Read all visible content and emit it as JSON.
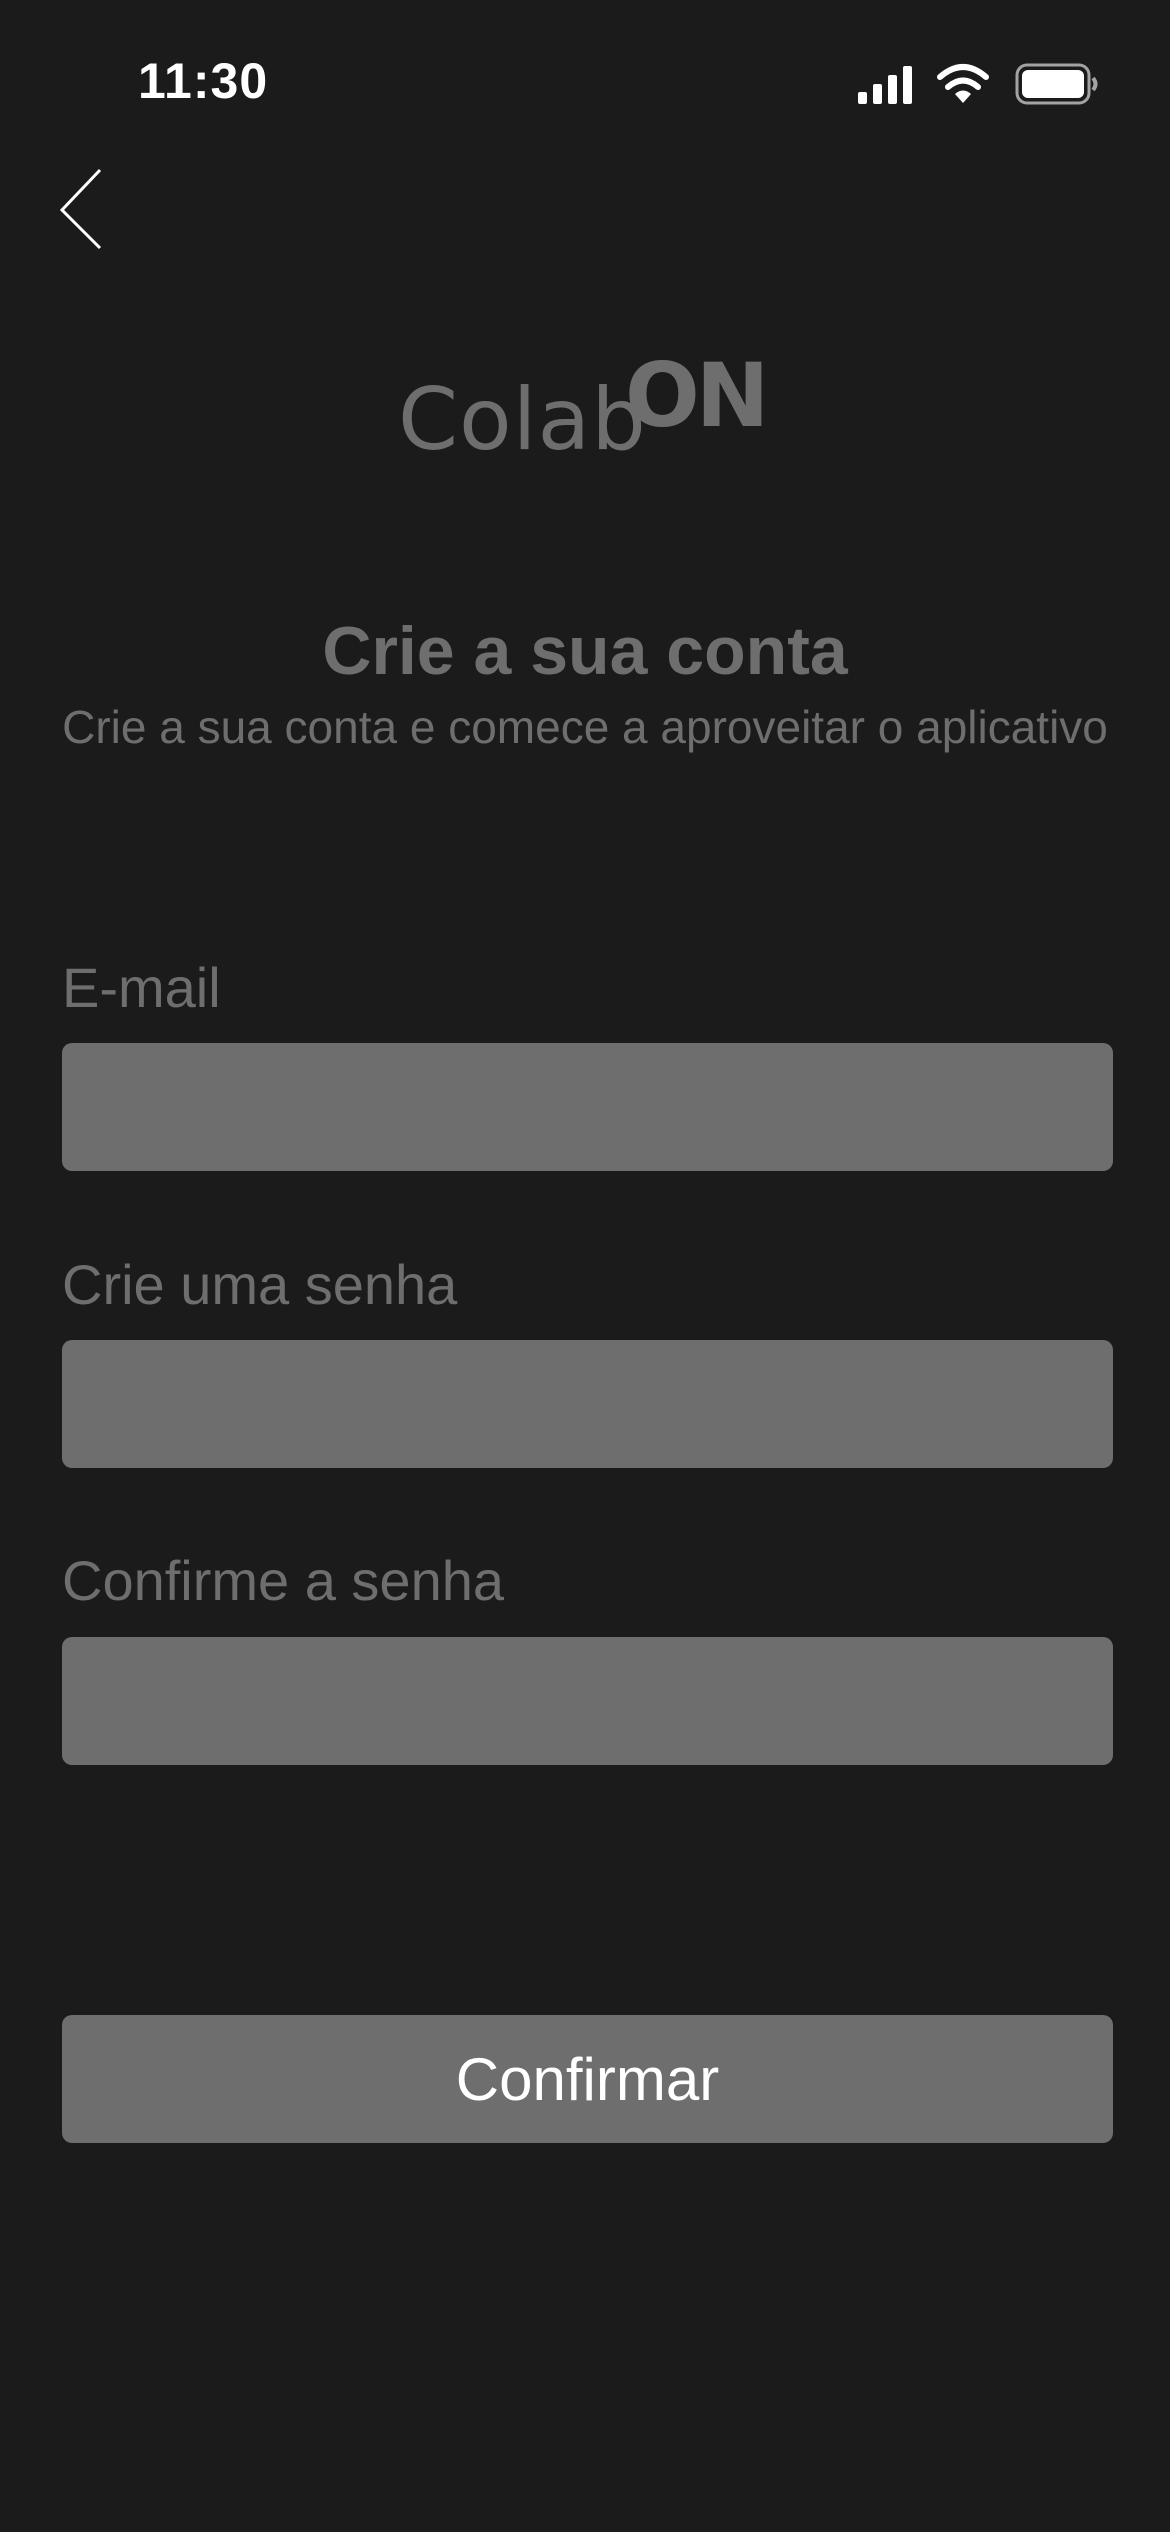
{
  "status_bar": {
    "time": "11:30",
    "icons": [
      "signal-icon",
      "wifi-icon",
      "battery-icon"
    ]
  },
  "header": {
    "back_icon": "chevron-left-icon"
  },
  "logo": {
    "part1": "Colab",
    "part2": "ON"
  },
  "title": "Crie a sua conta",
  "subtitle": "Crie a sua conta e comece a aproveitar o aplicativo",
  "form": {
    "email_label": "E-mail",
    "email_value": "",
    "password_label": "Crie uma senha",
    "password_value": "",
    "confirm_label": "Confirme a senha",
    "confirm_value": ""
  },
  "confirm_button": "Confirmar",
  "colors": {
    "background": "#1b1b1b",
    "muted": "#6e6e6e",
    "text_on_button": "#ffffff"
  }
}
